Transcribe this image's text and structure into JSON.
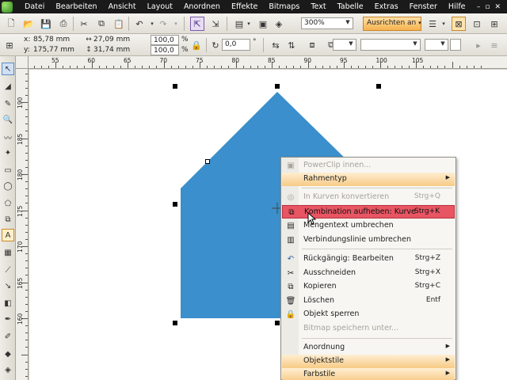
{
  "menubar": {
    "items": [
      "Datei",
      "Bearbeiten",
      "Ansicht",
      "Layout",
      "Anordnen",
      "Effekte",
      "Bitmaps",
      "Text",
      "Tabelle",
      "Extras",
      "Fenster",
      "Hilfe"
    ],
    "window_controls": [
      "–",
      "▫",
      "✕"
    ]
  },
  "toolbar": {
    "zoom_value": "300%",
    "align_label": "Ausrichten an"
  },
  "property_bar": {
    "x_label": "x:",
    "x_value": "85,78 mm",
    "y_label": "y:",
    "y_value": "175,77 mm",
    "width_value": "27,09 mm",
    "height_value": "31,74 mm",
    "scale_x": "100,0",
    "scale_y": "100,0",
    "percent_sign": "%",
    "rotation_value": "0,0",
    "degree_sign": "°"
  },
  "ruler": {
    "h_labels": [
      "55",
      "60",
      "65",
      "70",
      "75",
      "80",
      "85",
      "90",
      "95",
      "100",
      "105"
    ],
    "v_labels": [
      "190",
      "185",
      "180",
      "175",
      "170",
      "165",
      "160"
    ]
  },
  "canvas": {
    "shape_color": "#3a8fcc",
    "selection_color": "#000000"
  },
  "context_menu": {
    "items": [
      {
        "label": "PowerClip innen...",
        "shortcut": "",
        "disabled": true,
        "submenu": false,
        "highlight": false,
        "icon": "powerclip-icon"
      },
      {
        "label": "Rahmentyp",
        "shortcut": "",
        "disabled": false,
        "submenu": true,
        "highlight": false,
        "icon": ""
      },
      {
        "label": "In Kurven konvertieren",
        "shortcut": "Strg+Q",
        "disabled": true,
        "submenu": false,
        "highlight": false,
        "icon": "convert-curve-icon"
      },
      {
        "label": "Kombination aufheben: Kurve",
        "shortcut": "Strg+K",
        "disabled": false,
        "submenu": false,
        "highlight": true,
        "icon": "break-apart-icon"
      },
      {
        "label": "Mengentext umbrechen",
        "shortcut": "",
        "disabled": false,
        "submenu": false,
        "highlight": false,
        "icon": "wrap-text-icon"
      },
      {
        "label": "Verbindungslinie umbrechen",
        "shortcut": "",
        "disabled": false,
        "submenu": false,
        "highlight": false,
        "icon": "connector-icon"
      },
      {
        "label": "Rückgängig: Bearbeiten",
        "shortcut": "Strg+Z",
        "disabled": false,
        "submenu": false,
        "highlight": false,
        "icon": "undo-icon"
      },
      {
        "label": "Ausschneiden",
        "shortcut": "Strg+X",
        "disabled": false,
        "submenu": false,
        "highlight": false,
        "icon": "scissors-icon"
      },
      {
        "label": "Kopieren",
        "shortcut": "Strg+C",
        "disabled": false,
        "submenu": false,
        "highlight": false,
        "icon": "copy-icon"
      },
      {
        "label": "Löschen",
        "shortcut": "Entf",
        "disabled": false,
        "submenu": false,
        "highlight": false,
        "icon": "delete-icon"
      },
      {
        "label": "Objekt sperren",
        "shortcut": "",
        "disabled": false,
        "submenu": false,
        "highlight": false,
        "icon": "lock-icon"
      },
      {
        "label": "Bitmap speichern unter...",
        "shortcut": "",
        "disabled": true,
        "submenu": false,
        "highlight": false,
        "icon": ""
      },
      {
        "label": "Anordnung",
        "shortcut": "",
        "disabled": false,
        "submenu": true,
        "highlight": false,
        "icon": ""
      },
      {
        "label": "Objektstile",
        "shortcut": "",
        "disabled": false,
        "submenu": true,
        "highlight": false,
        "icon": ""
      },
      {
        "label": "Farbstile",
        "shortcut": "",
        "disabled": false,
        "submenu": true,
        "highlight": false,
        "icon": ""
      }
    ]
  }
}
